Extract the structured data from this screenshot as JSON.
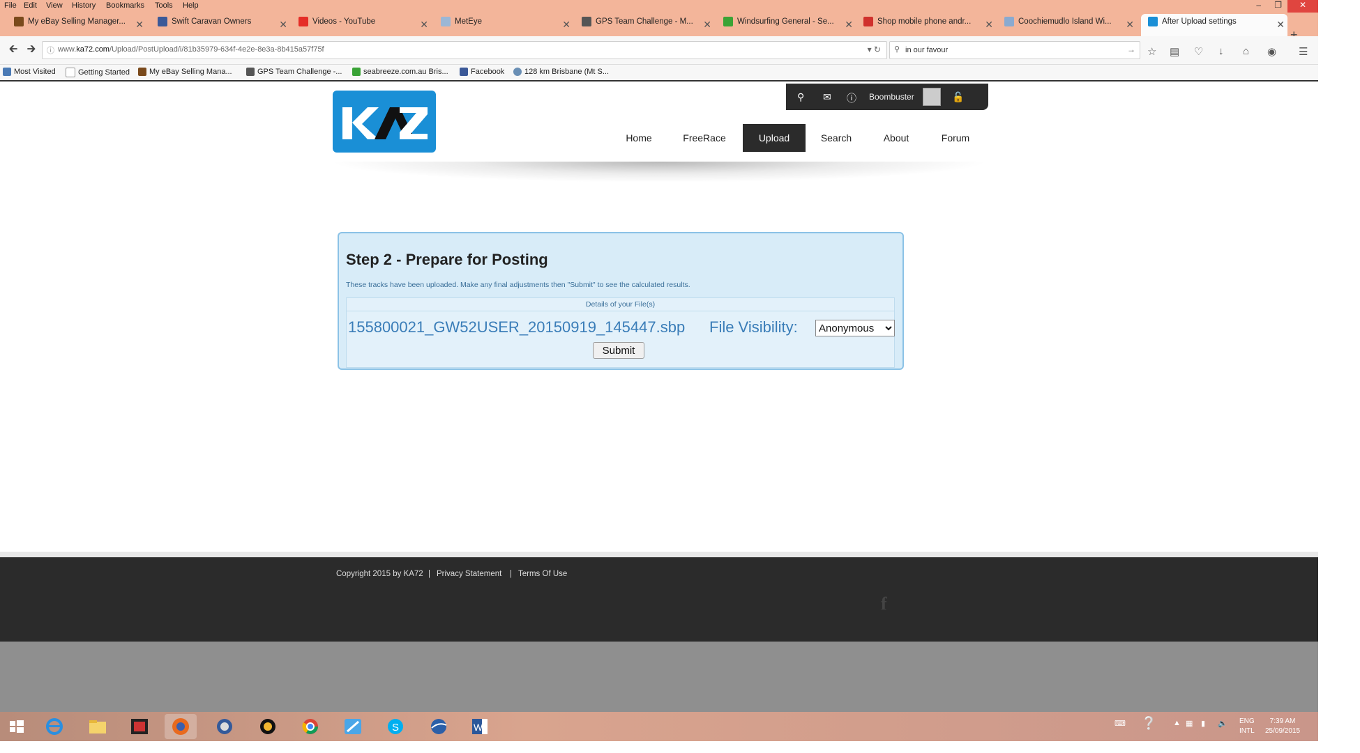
{
  "menubar": [
    "File",
    "Edit",
    "View",
    "History",
    "Bookmarks",
    "Tools",
    "Help"
  ],
  "tabs": [
    {
      "label": "My eBay Selling Manager...",
      "color": "#7a4a1c"
    },
    {
      "label": "Swift Caravan Owners",
      "color": "#3b5998"
    },
    {
      "label": "Videos - YouTube",
      "color": "#e52d27"
    },
    {
      "label": "MetEye",
      "color": "#9bb7d6"
    },
    {
      "label": "GPS Team Challenge - M...",
      "color": "#555555"
    },
    {
      "label": "Windsurfing General - Se...",
      "color": "#3aa336"
    },
    {
      "label": "Shop mobile phone andr...",
      "color": "#d0312d"
    },
    {
      "label": "Coochiemudlo Island Wi...",
      "color": "#8aaad0"
    },
    {
      "label": "After Upload settings",
      "color": "#1a8fd6"
    }
  ],
  "address": {
    "prefix": "www.",
    "domain": "ka72.com",
    "path": "/Upload/PostUpload/i/81b35979-634f-4e2e-8e3a-8b415a57f75f"
  },
  "search": {
    "value": "in our favour"
  },
  "bookmarks": [
    {
      "label": "Most Visited",
      "color": "#4a7ab5"
    },
    {
      "label": "Getting Started",
      "color": "#ffffff"
    },
    {
      "label": "My eBay Selling Mana...",
      "color": "#7a4a1c"
    },
    {
      "label": "GPS Team Challenge -...",
      "color": "#555555"
    },
    {
      "label": "seabreeze.com.au Bris...",
      "color": "#3aa336"
    },
    {
      "label": "Facebook",
      "color": "#3b5998"
    },
    {
      "label": "128 km Brisbane (Mt S...",
      "color": "#6a8fb5"
    }
  ],
  "site": {
    "logo_text": "KA72",
    "username": "Boombuster",
    "nav": [
      "Home",
      "FreeRace",
      "Upload",
      "Search",
      "About",
      "Forum"
    ],
    "active_nav": "Upload"
  },
  "panel": {
    "title": "Step 2 - Prepare for Posting",
    "description": "These tracks have been uploaded. Make any final adjustments then \"Submit\" to see the calculated results.",
    "details_header": "Details of your File(s)",
    "file_name": "155800021_GW52USER_20150919_145447.sbp",
    "visibility_label": "File Visibility:",
    "visibility_value": "Anonymous",
    "submit_label": "Submit"
  },
  "footer": {
    "copyright": "Copyright 2015 by KA72",
    "privacy": "Privacy Statement",
    "terms": "Terms Of Use",
    "separator": "|",
    "social": "f"
  },
  "system": {
    "lang_line1": "ENG",
    "lang_line2": "INTL",
    "time": "7:39 AM",
    "date": "25/09/2015"
  },
  "colors": {
    "chrome": "#f3b59a",
    "accent": "#1a8fd6",
    "panel_bg": "#d8ecf8",
    "panel_border": "#8bc2e6",
    "dark": "#2b2b2b"
  }
}
